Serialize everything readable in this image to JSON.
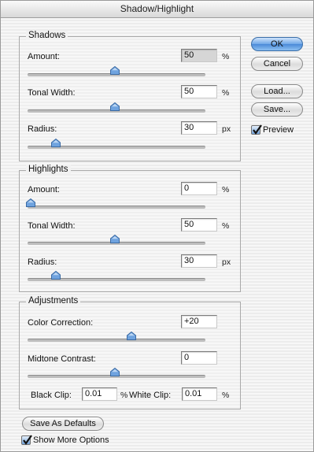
{
  "window": {
    "title": "Shadow/Highlight"
  },
  "shadows": {
    "title": "Shadows",
    "amount": {
      "label": "Amount:",
      "value": "50",
      "unit": "%",
      "level": 0.5
    },
    "tonal_width": {
      "label": "Tonal Width:",
      "value": "50",
      "unit": "%",
      "level": 0.5
    },
    "radius": {
      "label": "Radius:",
      "value": "30",
      "unit": "px",
      "level": 0.15
    }
  },
  "highlights": {
    "title": "Highlights",
    "amount": {
      "label": "Amount:",
      "value": "0",
      "unit": "%",
      "level": 0.0
    },
    "tonal_width": {
      "label": "Tonal Width:",
      "value": "50",
      "unit": "%",
      "level": 0.5
    },
    "radius": {
      "label": "Radius:",
      "value": "30",
      "unit": "px",
      "level": 0.15
    }
  },
  "adjustments": {
    "title": "Adjustments",
    "color_correction": {
      "label": "Color Correction:",
      "value": "+20",
      "level": 0.6
    },
    "midtone_contrast": {
      "label": "Midtone Contrast:",
      "value": "0",
      "level": 0.5
    },
    "black_clip": {
      "label": "Black Clip:",
      "value": "0.01",
      "unit": "%"
    },
    "white_clip": {
      "label": "White Clip:",
      "value": "0.01",
      "unit": "%"
    }
  },
  "buttons": {
    "ok": "OK",
    "cancel": "Cancel",
    "load": "Load...",
    "save": "Save...",
    "save_defaults": "Save As Defaults"
  },
  "preview": {
    "label": "Preview",
    "checked": true
  },
  "show_more": {
    "label": "Show More Options",
    "checked": true
  },
  "colors": {
    "accent": "#4a8ad8",
    "thumb": "#6fa3df"
  }
}
